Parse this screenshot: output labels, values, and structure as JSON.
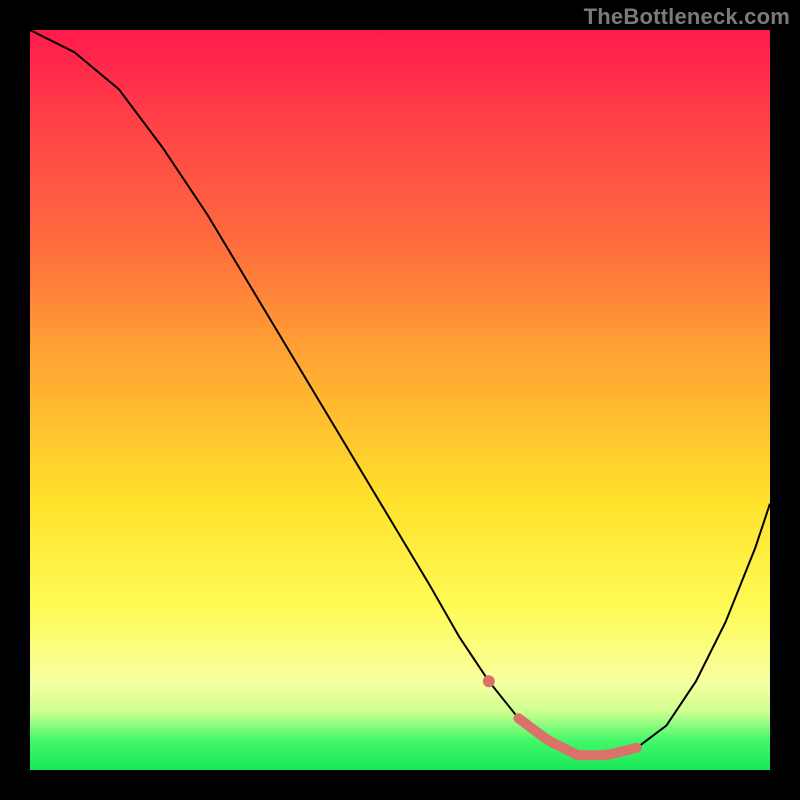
{
  "watermark": "TheBottleneck.com",
  "chart_data": {
    "type": "line",
    "title": "",
    "xlabel": "",
    "ylabel": "",
    "xlim": [
      0,
      100
    ],
    "ylim": [
      0,
      100
    ],
    "grid": false,
    "legend": false,
    "annotations": [],
    "background_gradient_stops": [
      {
        "pos": 0,
        "color": "#ff1a4d"
      },
      {
        "pos": 28,
        "color": "#ff6a3e"
      },
      {
        "pos": 63,
        "color": "#ffe02a"
      },
      {
        "pos": 88,
        "color": "#f7ffa0"
      },
      {
        "pos": 100,
        "color": "#18e858"
      }
    ],
    "series": [
      {
        "name": "bottleneck-curve",
        "x": [
          0,
          6,
          12,
          18,
          24,
          30,
          36,
          42,
          48,
          54,
          58,
          62,
          66,
          70,
          74,
          78,
          82,
          86,
          90,
          94,
          98,
          100
        ],
        "y": [
          100,
          97,
          92,
          84,
          75,
          65,
          55,
          45,
          35,
          25,
          18,
          12,
          7,
          4,
          2,
          2,
          3,
          6,
          12,
          20,
          30,
          36
        ]
      }
    ],
    "highlight": {
      "name": "optimal-range",
      "color": "#d9736a",
      "segment_x_range": [
        66,
        82
      ],
      "dot_x": 62
    }
  }
}
